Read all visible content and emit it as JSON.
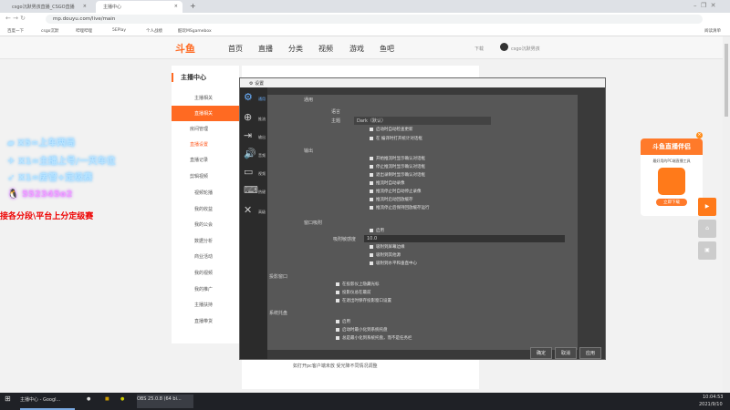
{
  "browser": {
    "tabs": [
      {
        "label": "csgo沉默男孩直播_CSGO直播"
      },
      {
        "label": "主播中心"
      }
    ],
    "new_tab": "+",
    "url": "mp.douyu.com/live/main",
    "bookmarks": [
      "百度一下",
      "csgo沉默",
      "哔哩哔哩",
      "5EPlay",
      "个人战绩",
      "酷玩MSgamebox"
    ],
    "reading_list": "阅读清单"
  },
  "site": {
    "logo": "斗鱼",
    "nav": [
      "首页",
      "直播",
      "分类",
      "视频",
      "游戏",
      "鱼吧"
    ],
    "download": "下载",
    "user": "csgo沉默男孩"
  },
  "sidebar": {
    "title": "主播中心",
    "items": [
      {
        "label": "主播相关",
        "type": "group"
      },
      {
        "label": "直播相关",
        "type": "active"
      },
      {
        "label": "房间管理",
        "type": "sub"
      },
      {
        "label": "直播设置",
        "type": "sub-active"
      },
      {
        "label": "直播记录",
        "type": "sub"
      },
      {
        "label": "剪辑视频",
        "type": "sub"
      },
      {
        "label": "视频轮播",
        "type": "group"
      },
      {
        "label": "我的收益",
        "type": "group"
      },
      {
        "label": "我的公会",
        "type": "group"
      },
      {
        "label": "数据分析",
        "type": "group"
      },
      {
        "label": "商业活动",
        "type": "group"
      },
      {
        "label": "我的视频",
        "type": "group"
      },
      {
        "label": "我的推广",
        "type": "group"
      },
      {
        "label": "主播扶持",
        "type": "group"
      },
      {
        "label": "直播带货",
        "type": "group"
      }
    ]
  },
  "overlay": {
    "lines": [
      "X5=上车两局",
      "X1=主播上号/一天车位",
      "X1=房管+定级赛"
    ],
    "qq": "552345o2",
    "note": "接各分段\\平台上分定级赛"
  },
  "obs": {
    "title": "设置",
    "nav": [
      "通用",
      "推流",
      "输出",
      "音频",
      "视频",
      "热键",
      "高级"
    ],
    "section_general": "通用",
    "language": "语言",
    "theme_label": "主题",
    "theme_value": "Dark（默认）",
    "checks": [
      "启动时自动检查更新",
      "在 编译时打开统计对话框",
      "开始推流时显示确认对话框",
      "停止推流时显示确认对话框",
      "退出录制时显示确认对话框",
      "推流时自动录像",
      "推流停止时自动停止录像",
      "推流时启动回放缓存",
      "推流停止后保持回放缓存运行"
    ],
    "output_label": "输出",
    "snap_label": "窗口吸附",
    "enable": "启用",
    "snap_sensitivity": "吸附敏感度",
    "snap_value": "10.0",
    "snap_checks": [
      "吸附到屏幕边缘",
      "吸附到其他源",
      "吸附到水平和垂直中心"
    ],
    "projector_label": "投影窗口",
    "projector_checks": [
      "在投影仪上隐藏光标",
      "投影仪总在最前",
      "在退出时保存投影窗口设置"
    ],
    "tray_label": "系统托盘",
    "tray_checks": [
      "启用",
      "启动时最小化到系统托盘",
      "总是最小化到系统托盘，而不是任务栏"
    ],
    "ok": "确定",
    "cancel": "取消",
    "apply": "应用"
  },
  "page_hint": "如打开pc客户端未放 受光降不同情况调整",
  "ad": {
    "title": "斗鱼直播伴侣",
    "subtitle": "最好用的PC端直播工具",
    "button": "立即下载"
  },
  "taskbar": {
    "chrome": "主播中心 - Googl...",
    "obs": "OBS 25.0.8 (64 bi...",
    "time": "10:04:53",
    "date": "2021/9/10"
  }
}
